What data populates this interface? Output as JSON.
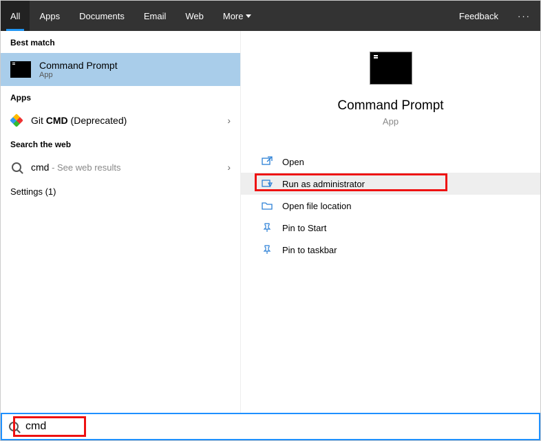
{
  "topbar": {
    "tabs": [
      "All",
      "Apps",
      "Documents",
      "Email",
      "Web",
      "More"
    ],
    "feedback": "Feedback"
  },
  "left": {
    "best_match_header": "Best match",
    "best_match": {
      "title": "Command Prompt",
      "subtitle": "App"
    },
    "apps_header": "Apps",
    "git_prefix": "Git ",
    "git_bold": "CMD",
    "git_suffix": " (Deprecated)",
    "search_web_header": "Search the web",
    "web_query": "cmd",
    "web_suffix": " - See web results",
    "settings": "Settings (1)"
  },
  "right": {
    "title": "Command Prompt",
    "subtitle": "App",
    "actions": {
      "open": "Open",
      "run_admin": "Run as administrator",
      "open_loc": "Open file location",
      "pin_start": "Pin to Start",
      "pin_taskbar": "Pin to taskbar"
    }
  },
  "search": {
    "value": "cmd"
  }
}
